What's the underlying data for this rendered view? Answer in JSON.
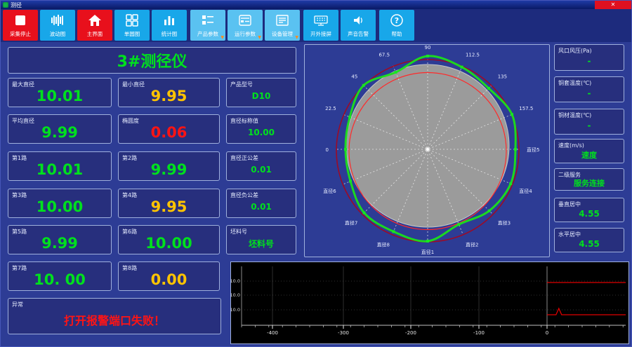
{
  "window": {
    "title": "测径",
    "close_glyph": "✕"
  },
  "toolbar": {
    "buttons": [
      {
        "label": "采集停止"
      },
      {
        "label": "波动图"
      },
      {
        "label": "主界面"
      },
      {
        "label": "单圆图"
      },
      {
        "label": "统计图"
      },
      {
        "label": "产品参数",
        "dropdown": "▼"
      },
      {
        "label": "运行参数",
        "dropdown": "▼"
      },
      {
        "label": "设备管理",
        "dropdown": "▼"
      },
      {
        "label": "开外接屏"
      },
      {
        "label": "声音告警"
      },
      {
        "label": "帮助"
      }
    ]
  },
  "left_panel": {
    "title": "3#测径仪",
    "max": {
      "label": "最大直径",
      "value": "10.01"
    },
    "min": {
      "label": "最小直径",
      "value": "9.95"
    },
    "product": {
      "label": "产品型号",
      "value": "D10"
    },
    "avg": {
      "label": "平均直径",
      "value": "9.99"
    },
    "ovality": {
      "label": "椭圆度",
      "value": "0.06"
    },
    "nominal": {
      "label": "直径标称值",
      "value": "10.00"
    },
    "ch1": {
      "label": "第1路",
      "value": "10.01"
    },
    "ch2": {
      "label": "第2路",
      "value": "9.99"
    },
    "tol_plus": {
      "label": "直径正公差",
      "value": "0.01"
    },
    "ch3": {
      "label": "第3路",
      "value": "10.00"
    },
    "ch4": {
      "label": "第4路",
      "value": "9.95"
    },
    "tol_minus": {
      "label": "直径负公差",
      "value": "0.01"
    },
    "ch5": {
      "label": "第5路",
      "value": "9.99"
    },
    "ch6": {
      "label": "第6路",
      "value": "10.00"
    },
    "billet": {
      "label": "坯料号",
      "value": "坯料号"
    },
    "ch7": {
      "label": "第7路",
      "value": "10. 00"
    },
    "ch8": {
      "label": "第8路",
      "value": "0.00"
    },
    "alarm": {
      "label": "异常",
      "value": "打开报警端口失败！"
    }
  },
  "right_panel": {
    "boxes": [
      {
        "label": "风口风压(Pa)",
        "value": "-"
      },
      {
        "label": "铜套温度(℃)",
        "value": "-"
      },
      {
        "label": "铜材温度(℃)",
        "value": "-"
      },
      {
        "label": "速度(m/s)",
        "value": "速度"
      },
      {
        "label": "二级服务",
        "value": "服务连接"
      },
      {
        "label": "垂直居中",
        "value": "4.55"
      },
      {
        "label": "水平居中",
        "value": "4.55"
      }
    ]
  },
  "colors": {
    "ok_green": "#00e01e",
    "warn_yellow": "#ffc400",
    "alarm_red": "#ff1414",
    "accent_blue": "#18a7e9",
    "active_red": "#e8101c"
  },
  "chart_data": [
    {
      "type": "polar-profile",
      "angle_labels": [
        "0",
        "22.5",
        "45",
        "67.5",
        "90",
        "112.5",
        "135",
        "157.5"
      ],
      "diameter_labels": [
        "直径5",
        "直径4",
        "直径3",
        "直径2",
        "直径1",
        "直径8",
        "直径7",
        "直径6"
      ],
      "profile": [
        117,
        120,
        129,
        119,
        133,
        127,
        123,
        130,
        125,
        128,
        124,
        116,
        131,
        127,
        128,
        119
      ],
      "channel_values": {
        "直径1": 10.01,
        "直径2": 9.99,
        "直径3": 10.0,
        "直径4": 9.95,
        "直径5": 9.99,
        "直径6": 10.0,
        "直径7": 10.0,
        "直径8": 0.0
      },
      "disc_color": "#9b9b9b",
      "nominal_circle_color": "#ff2a2a",
      "outer_circle_color": "#9c0b27",
      "profile_color": "#1ae01a",
      "marker_color": "#17e523"
    },
    {
      "type": "line",
      "x_ticks": [
        "-400",
        "-300",
        "-200",
        "-100",
        "0"
      ],
      "y_ticks": [
        "10.0",
        "10.0",
        "10.0"
      ],
      "series": [
        {
          "name": "upper-trace",
          "color": "#e00000",
          "x_start": 0,
          "x_end": 120,
          "level": 0
        },
        {
          "name": "lower-trace",
          "color": "#e00000",
          "x_start": 0,
          "x_end": 120,
          "level": 2,
          "spike_x": 18
        }
      ],
      "bg": "#000000",
      "grid": true,
      "xlim": [
        -450,
        120
      ]
    }
  ]
}
